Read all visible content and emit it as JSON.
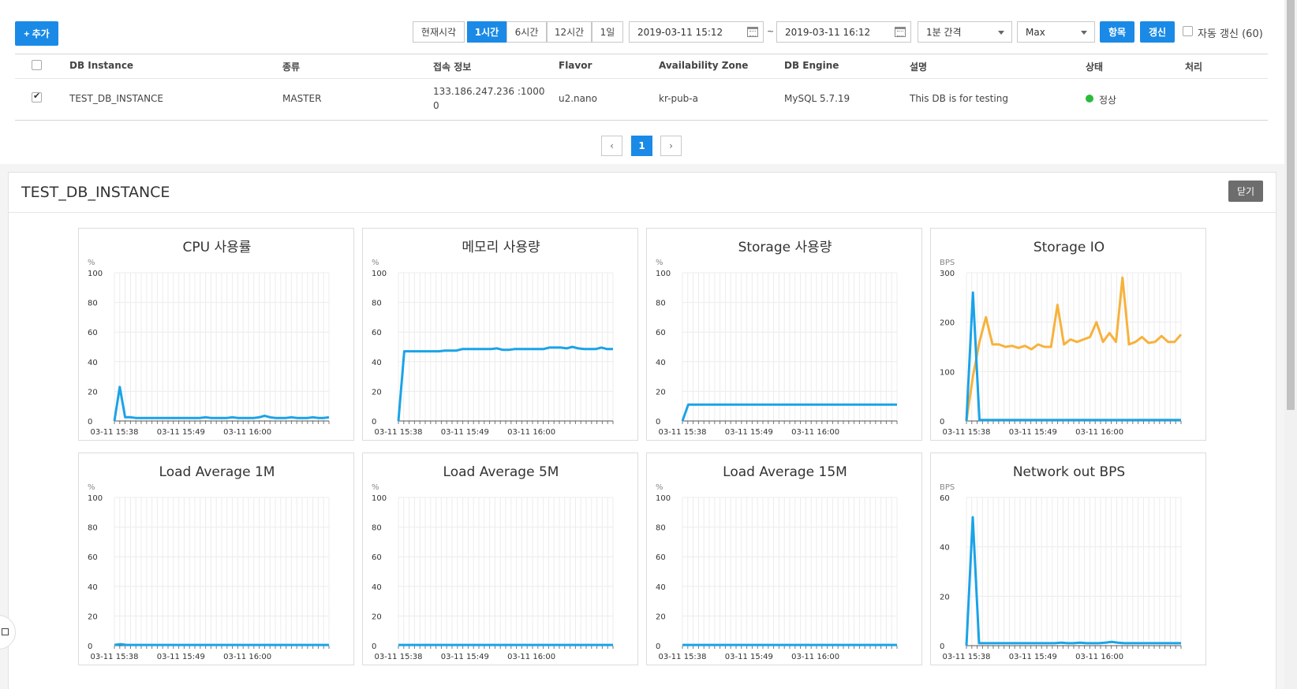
{
  "toolbar": {
    "add_label": "+ 추가",
    "range_buttons": [
      {
        "label": "현재시각",
        "active": false
      },
      {
        "label": "1시간",
        "active": true
      },
      {
        "label": "6시간",
        "active": false
      },
      {
        "label": "12시간",
        "active": false
      },
      {
        "label": "1일",
        "active": false
      }
    ],
    "start_time": "2019-03-11 15:12",
    "tilde": "~",
    "end_time": "2019-03-11 16:12",
    "interval": "1분 간격",
    "aggregate": "Max",
    "items_label": "항목",
    "refresh_label": "갱신",
    "auto_refresh_label": "자동 갱신 (60)"
  },
  "table": {
    "headers": [
      "DB Instance",
      "종류",
      "접속 정보",
      "Flavor",
      "Availability Zone",
      "DB Engine",
      "설명",
      "상태",
      "처리"
    ],
    "rows": [
      {
        "checked": true,
        "instance": "TEST_DB_INSTANCE",
        "type": "MASTER",
        "conn_line1": "133.186.247.236 :1000",
        "conn_line2": "0",
        "flavor": "u2.nano",
        "zone": "kr-pub-a",
        "engine": "MySQL 5.7.19",
        "description": "This DB is for testing",
        "status": "정상"
      }
    ]
  },
  "pagination": {
    "prev": "‹",
    "current": "1",
    "next": "›"
  },
  "panel": {
    "title": "TEST_DB_INSTANCE",
    "close_label": "닫기"
  },
  "colors": {
    "primary": "#1a8ae6",
    "series_blue": "#1aa3e8",
    "series_orange": "#f7b23b",
    "status_ok": "#2bbb3c"
  },
  "chart_data": [
    {
      "type": "line",
      "title": "CPU 사용률",
      "unit": "%",
      "ylim": [
        0,
        100
      ],
      "yticks": [
        0,
        20,
        40,
        60,
        80,
        100
      ],
      "xlabels": [
        "03-11 15:38",
        "03-11 15:49",
        "03-11 16:00"
      ],
      "grid": true,
      "series": [
        {
          "color": "#1aa3e8",
          "values": [
            0,
            23,
            2.5,
            2.5,
            2,
            2,
            2,
            2,
            2,
            2,
            2,
            2,
            2,
            2,
            2,
            2,
            2,
            2.5,
            2,
            2,
            2,
            2,
            2.5,
            2,
            2,
            2,
            2,
            2.5,
            3.5,
            2.5,
            2,
            2,
            2,
            2.5,
            2,
            2,
            2,
            2.5,
            2,
            2,
            2.5
          ]
        }
      ]
    },
    {
      "type": "line",
      "title": "메모리 사용량",
      "unit": "%",
      "ylim": [
        0,
        100
      ],
      "yticks": [
        0,
        20,
        40,
        60,
        80,
        100
      ],
      "xlabels": [
        "03-11 15:38",
        "03-11 15:49",
        "03-11 16:00"
      ],
      "grid": true,
      "series": [
        {
          "color": "#1aa3e8",
          "values": [
            0,
            47,
            47,
            47,
            47,
            47,
            47,
            47,
            47.5,
            47.5,
            47.5,
            48.5,
            48.5,
            48.5,
            48.5,
            48.5,
            48.5,
            49,
            48,
            48,
            48.5,
            48.5,
            48.5,
            48.5,
            48.5,
            48.5,
            49.5,
            49.5,
            49.5,
            49,
            50,
            49,
            48.5,
            48.5,
            48.5,
            49.5,
            48.5,
            48.5
          ]
        }
      ]
    },
    {
      "type": "line",
      "title": "Storage 사용량",
      "unit": "%",
      "ylim": [
        0,
        100
      ],
      "yticks": [
        0,
        20,
        40,
        60,
        80,
        100
      ],
      "xlabels": [
        "03-11 15:38",
        "03-11 15:49",
        "03-11 16:00"
      ],
      "grid": true,
      "series": [
        {
          "color": "#1aa3e8",
          "values": [
            0,
            11,
            11,
            11,
            11,
            11,
            11,
            11,
            11,
            11,
            11,
            11,
            11,
            11,
            11,
            11,
            11,
            11,
            11,
            11,
            11,
            11,
            11,
            11,
            11,
            11,
            11,
            11,
            11,
            11,
            11,
            11,
            11,
            11,
            11,
            11,
            11,
            11
          ]
        }
      ]
    },
    {
      "type": "line",
      "title": "Storage IO",
      "unit": "BPS",
      "ylim": [
        0,
        300
      ],
      "yticks": [
        0,
        100,
        200,
        300
      ],
      "xlabels": [
        "03-11 15:38",
        "03-11 15:49",
        "03-11 16:00"
      ],
      "grid": true,
      "series": [
        {
          "color": "#f7b23b",
          "values": [
            0,
            90,
            160,
            210,
            155,
            155,
            150,
            152,
            148,
            152,
            145,
            155,
            150,
            150,
            235,
            155,
            165,
            160,
            165,
            170,
            200,
            160,
            178,
            160,
            290,
            155,
            160,
            170,
            158,
            160,
            172,
            160,
            160,
            175
          ]
        },
        {
          "color": "#1aa3e8",
          "values": [
            0,
            260,
            2,
            2,
            2,
            2,
            2,
            2,
            2,
            2,
            2,
            2,
            2,
            2,
            2,
            2,
            2,
            2,
            2,
            2,
            2,
            2,
            2,
            2,
            2,
            2,
            2,
            2,
            2,
            2,
            2,
            2,
            2,
            2
          ]
        }
      ]
    },
    {
      "type": "line",
      "title": "Load Average 1M",
      "unit": "%",
      "ylim": [
        0,
        100
      ],
      "yticks": [
        0,
        20,
        40,
        60,
        80,
        100
      ],
      "xlabels": [
        "03-11 15:38",
        "03-11 15:49",
        "03-11 16:00"
      ],
      "grid": true,
      "series": [
        {
          "color": "#1aa3e8",
          "values": [
            0.5,
            1,
            0.5,
            0.5,
            0.5,
            0.5,
            0.5,
            0.5,
            0.5,
            0.5,
            0.5,
            0.5,
            0.5,
            0.5,
            0.5,
            0.5,
            0.5,
            0.5,
            0.5,
            0.5,
            0.5,
            0.5,
            0.5,
            0.5,
            0.5,
            0.5,
            0.5,
            0.5,
            0.5,
            0.5,
            0.5,
            0.5,
            0.5,
            0.5,
            0.5,
            0.5
          ]
        }
      ]
    },
    {
      "type": "line",
      "title": "Load Average 5M",
      "unit": "%",
      "ylim": [
        0,
        100
      ],
      "yticks": [
        0,
        20,
        40,
        60,
        80,
        100
      ],
      "xlabels": [
        "03-11 15:38",
        "03-11 15:49",
        "03-11 16:00"
      ],
      "grid": true,
      "series": [
        {
          "color": "#1aa3e8",
          "values": [
            0.5,
            0.5,
            0.5,
            0.5,
            0.5,
            0.5,
            0.5,
            0.5,
            0.5,
            0.5,
            0.5,
            0.5,
            0.5,
            0.5,
            0.5,
            0.5,
            0.5,
            0.5,
            0.5,
            0.5,
            0.5,
            0.5,
            0.5,
            0.5,
            0.5,
            0.5,
            0.5,
            0.5,
            0.5,
            0.5,
            0.5,
            0.5,
            0.5,
            0.5,
            0.5,
            0.5
          ]
        }
      ]
    },
    {
      "type": "line",
      "title": "Load Average 15M",
      "unit": "%",
      "ylim": [
        0,
        100
      ],
      "yticks": [
        0,
        20,
        40,
        60,
        80,
        100
      ],
      "xlabels": [
        "03-11 15:38",
        "03-11 15:49",
        "03-11 16:00"
      ],
      "grid": true,
      "series": [
        {
          "color": "#1aa3e8",
          "values": [
            0.5,
            0.5,
            0.5,
            0.5,
            0.5,
            0.5,
            0.5,
            0.5,
            0.5,
            0.5,
            0.5,
            0.5,
            0.5,
            0.5,
            0.5,
            0.5,
            0.5,
            0.5,
            0.5,
            0.5,
            0.5,
            0.5,
            0.5,
            0.5,
            0.5,
            0.5,
            0.5,
            0.5,
            0.5,
            0.5,
            0.5,
            0.5,
            0.5,
            0.5,
            0.5,
            0.5
          ]
        }
      ]
    },
    {
      "type": "line",
      "title": "Network out BPS",
      "unit": "BPS",
      "ylim": [
        0,
        60
      ],
      "yticks": [
        0,
        20,
        40,
        60
      ],
      "xlabels": [
        "03-11 15:38",
        "03-11 15:49",
        "03-11 16:00"
      ],
      "grid": true,
      "series": [
        {
          "color": "#1aa3e8",
          "values": [
            0,
            52,
            1,
            1,
            1,
            1,
            1,
            1,
            1,
            1,
            1,
            1,
            1,
            1,
            1,
            1.2,
            1,
            1,
            1.2,
            1,
            1,
            1,
            1.2,
            1.5,
            1.2,
            1,
            1,
            1,
            1,
            1,
            1,
            1,
            1,
            1,
            1
          ]
        }
      ]
    }
  ]
}
